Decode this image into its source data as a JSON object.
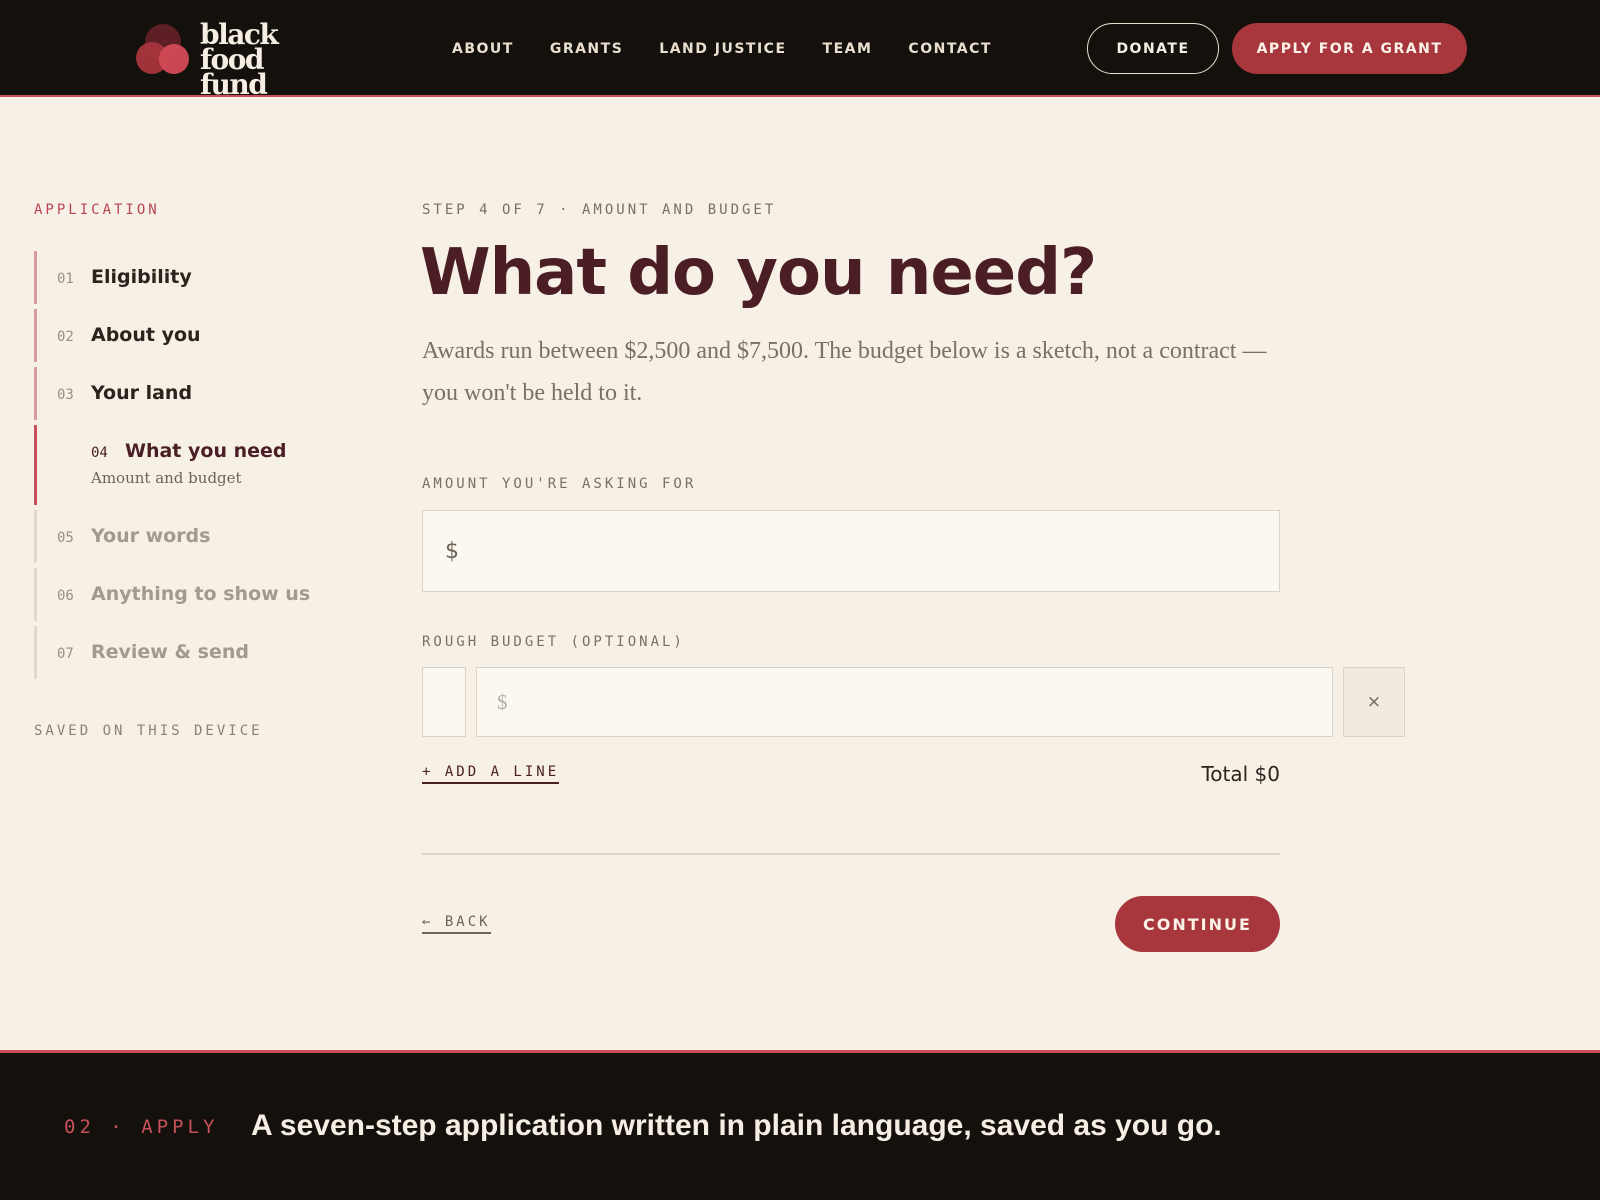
{
  "brand": {
    "logo_line1": "black",
    "logo_line2": "food fund",
    "accent": "#a8363d",
    "dark": "#14110c",
    "cream": "#f7f0e6"
  },
  "nav": {
    "items": [
      {
        "label": "ABOUT"
      },
      {
        "label": "GRANTS"
      },
      {
        "label": "LAND JUSTICE"
      },
      {
        "label": "TEAM"
      },
      {
        "label": "CONTACT"
      }
    ]
  },
  "header": {
    "donate_label": "DONATE",
    "apply_label": "APPLY FOR A GRANT"
  },
  "sidebar": {
    "label": "APPLICATION",
    "steps": [
      {
        "num": "01",
        "title": "Eligibility"
      },
      {
        "num": "02",
        "title": "About you"
      },
      {
        "num": "03",
        "title": "Your land"
      },
      {
        "num": "04",
        "title": "What you need",
        "subtitle": "Amount and budget"
      },
      {
        "num": "05",
        "title": "Your words"
      },
      {
        "num": "06",
        "title": "Anything to show us"
      },
      {
        "num": "07",
        "title": "Review & send"
      }
    ],
    "saved_note": "SAVED ON THIS DEVICE"
  },
  "main": {
    "eyebrow": "STEP 4 OF 7 · AMOUNT AND BUDGET",
    "title": "What do you need?",
    "lead": "Awards run between $2,500 and $7,500. The budget below is a sketch, not a contract — you won't be held to it.",
    "amount_label": "AMOUNT YOU'RE ASKING FOR",
    "amount_currency": "$",
    "amount_value": "",
    "budget_label": "ROUGH BUDGET (OPTIONAL)",
    "budget_line": {
      "item": "",
      "currency": "$",
      "remove": "×"
    },
    "add_line": "+ ADD A LINE",
    "total": "Total $0",
    "back": "← BACK",
    "continue": "CONTINUE"
  },
  "band": {
    "tag": "02 · APPLY",
    "text": "A seven-step application written in plain language, saved as you go."
  }
}
